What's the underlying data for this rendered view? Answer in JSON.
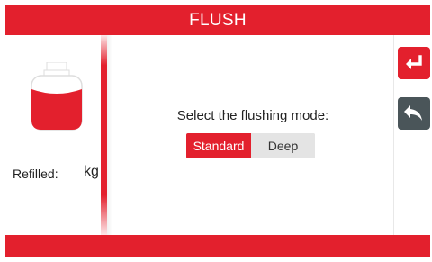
{
  "header": {
    "title": "FLUSH"
  },
  "sidebar": {
    "refill_label": "Refilled:",
    "refill_value": "",
    "refill_unit": "kg",
    "tank_icon": "gas-cylinder-icon",
    "tank_fill_color": "#e3202d"
  },
  "main": {
    "prompt": "Select the flushing mode:",
    "modes": [
      {
        "label": "Standard",
        "selected": true
      },
      {
        "label": "Deep",
        "selected": false
      }
    ]
  },
  "actions": {
    "enter_icon": "enter-return-icon",
    "back_icon": "back-arrow-icon"
  },
  "colors": {
    "accent": "#e3202d",
    "back_button": "#4a5559",
    "toggle_background": "#e4e4e4"
  }
}
